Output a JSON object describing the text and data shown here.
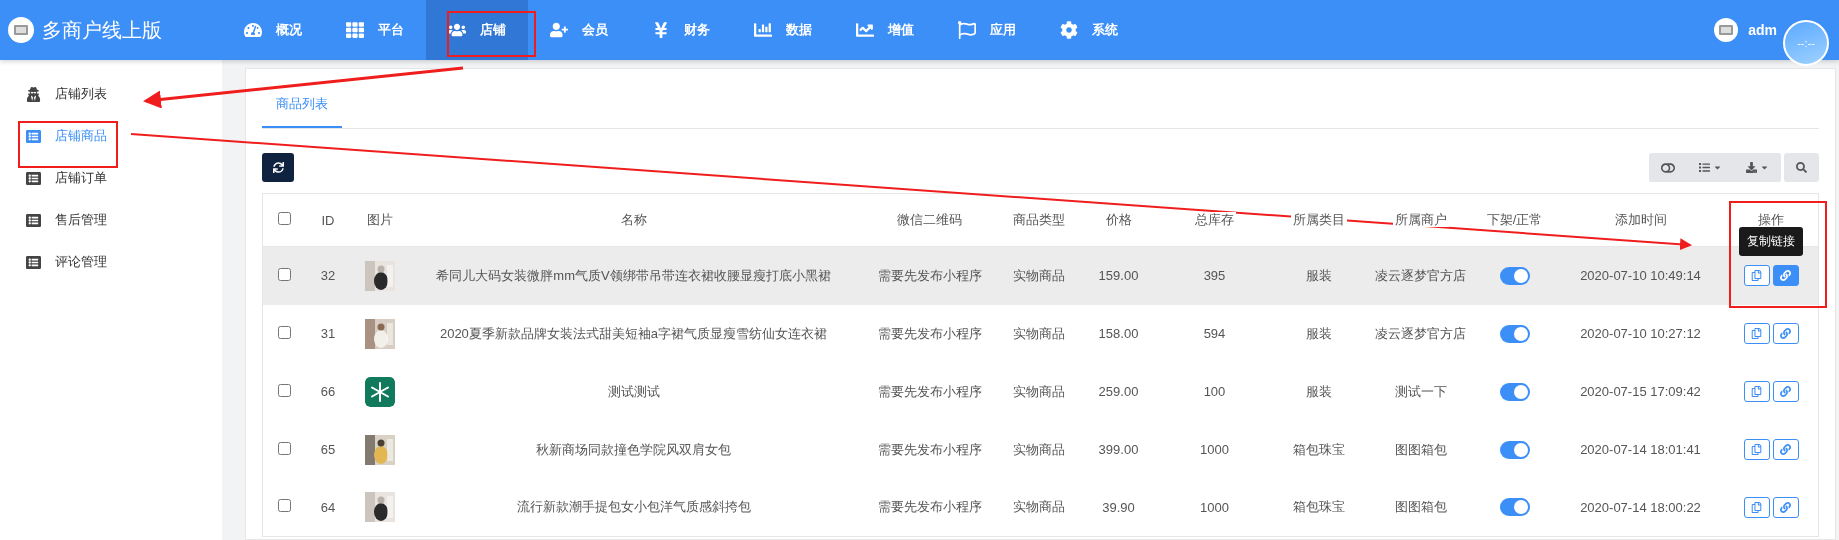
{
  "header": {
    "brand": "多商户线上版",
    "nav": [
      {
        "label": "概况",
        "selected": false
      },
      {
        "label": "平台",
        "selected": false
      },
      {
        "label": "店铺",
        "selected": true
      },
      {
        "label": "会员",
        "selected": false
      },
      {
        "label": "财务",
        "selected": false
      },
      {
        "label": "数据",
        "selected": false
      },
      {
        "label": "增值",
        "selected": false
      },
      {
        "label": "应用",
        "selected": false
      },
      {
        "label": "系统",
        "selected": false
      }
    ],
    "user": "adm",
    "clock": "--:--"
  },
  "sidebar": {
    "items": [
      {
        "label": "店铺列表",
        "selected": false
      },
      {
        "label": "店铺商品",
        "selected": true
      },
      {
        "label": "店铺订单",
        "selected": false
      },
      {
        "label": "售后管理",
        "selected": false
      },
      {
        "label": "评论管理",
        "selected": false
      }
    ]
  },
  "tabs": [
    {
      "label": "商品列表",
      "selected": true
    }
  ],
  "table": {
    "select_all_checked": false,
    "columns": [
      "ID",
      "图片",
      "名称",
      "微信二维码",
      "商品类型",
      "价格",
      "总库存",
      "所属类目",
      "所属商户",
      "下架/正常",
      "添加时间",
      "操作"
    ],
    "rows": [
      {
        "checked": false,
        "highlighted": true,
        "id": "32",
        "name": "希同儿大码女装微胖mm气质V领绑带吊带连衣裙收腰显瘦打底小黑裙",
        "qrcode": "需要先发布小程序",
        "type": "实物商品",
        "price": "159.00",
        "stock": "395",
        "category": "服装",
        "merchant": "凌云逐梦官方店",
        "on": true,
        "added": "2020-07-10 10:49:14",
        "tooltip": "复制链接"
      },
      {
        "checked": false,
        "highlighted": false,
        "id": "31",
        "name": "2020夏季新款品牌女装法式甜美短袖a字裙气质显瘦雪纺仙女连衣裙",
        "qrcode": "需要先发布小程序",
        "type": "实物商品",
        "price": "158.00",
        "stock": "594",
        "category": "服装",
        "merchant": "凌云逐梦官方店",
        "on": true,
        "added": "2020-07-10 10:27:12"
      },
      {
        "checked": false,
        "highlighted": false,
        "id": "66",
        "kind": "logo",
        "name": "测试测试",
        "qrcode": "需要先发布小程序",
        "type": "实物商品",
        "price": "259.00",
        "stock": "100",
        "category": "服装",
        "merchant": "测试一下",
        "on": true,
        "added": "2020-07-15 17:09:42"
      },
      {
        "checked": false,
        "highlighted": false,
        "id": "65",
        "name": "秋新商场同款撞色学院风双肩女包",
        "qrcode": "需要先发布小程序",
        "type": "实物商品",
        "price": "399.00",
        "stock": "1000",
        "category": "箱包珠宝",
        "merchant": "图图箱包",
        "on": true,
        "added": "2020-07-14 18:01:41"
      },
      {
        "checked": false,
        "highlighted": false,
        "id": "64",
        "name": "流行新款潮手提包女小包洋气质感斜挎包",
        "qrcode": "需要先发布小程序",
        "type": "实物商品",
        "price": "39.90",
        "stock": "1000",
        "category": "箱包珠宝",
        "merchant": "图图箱包",
        "on": true,
        "added": "2020-07-14 18:00:22"
      }
    ]
  }
}
